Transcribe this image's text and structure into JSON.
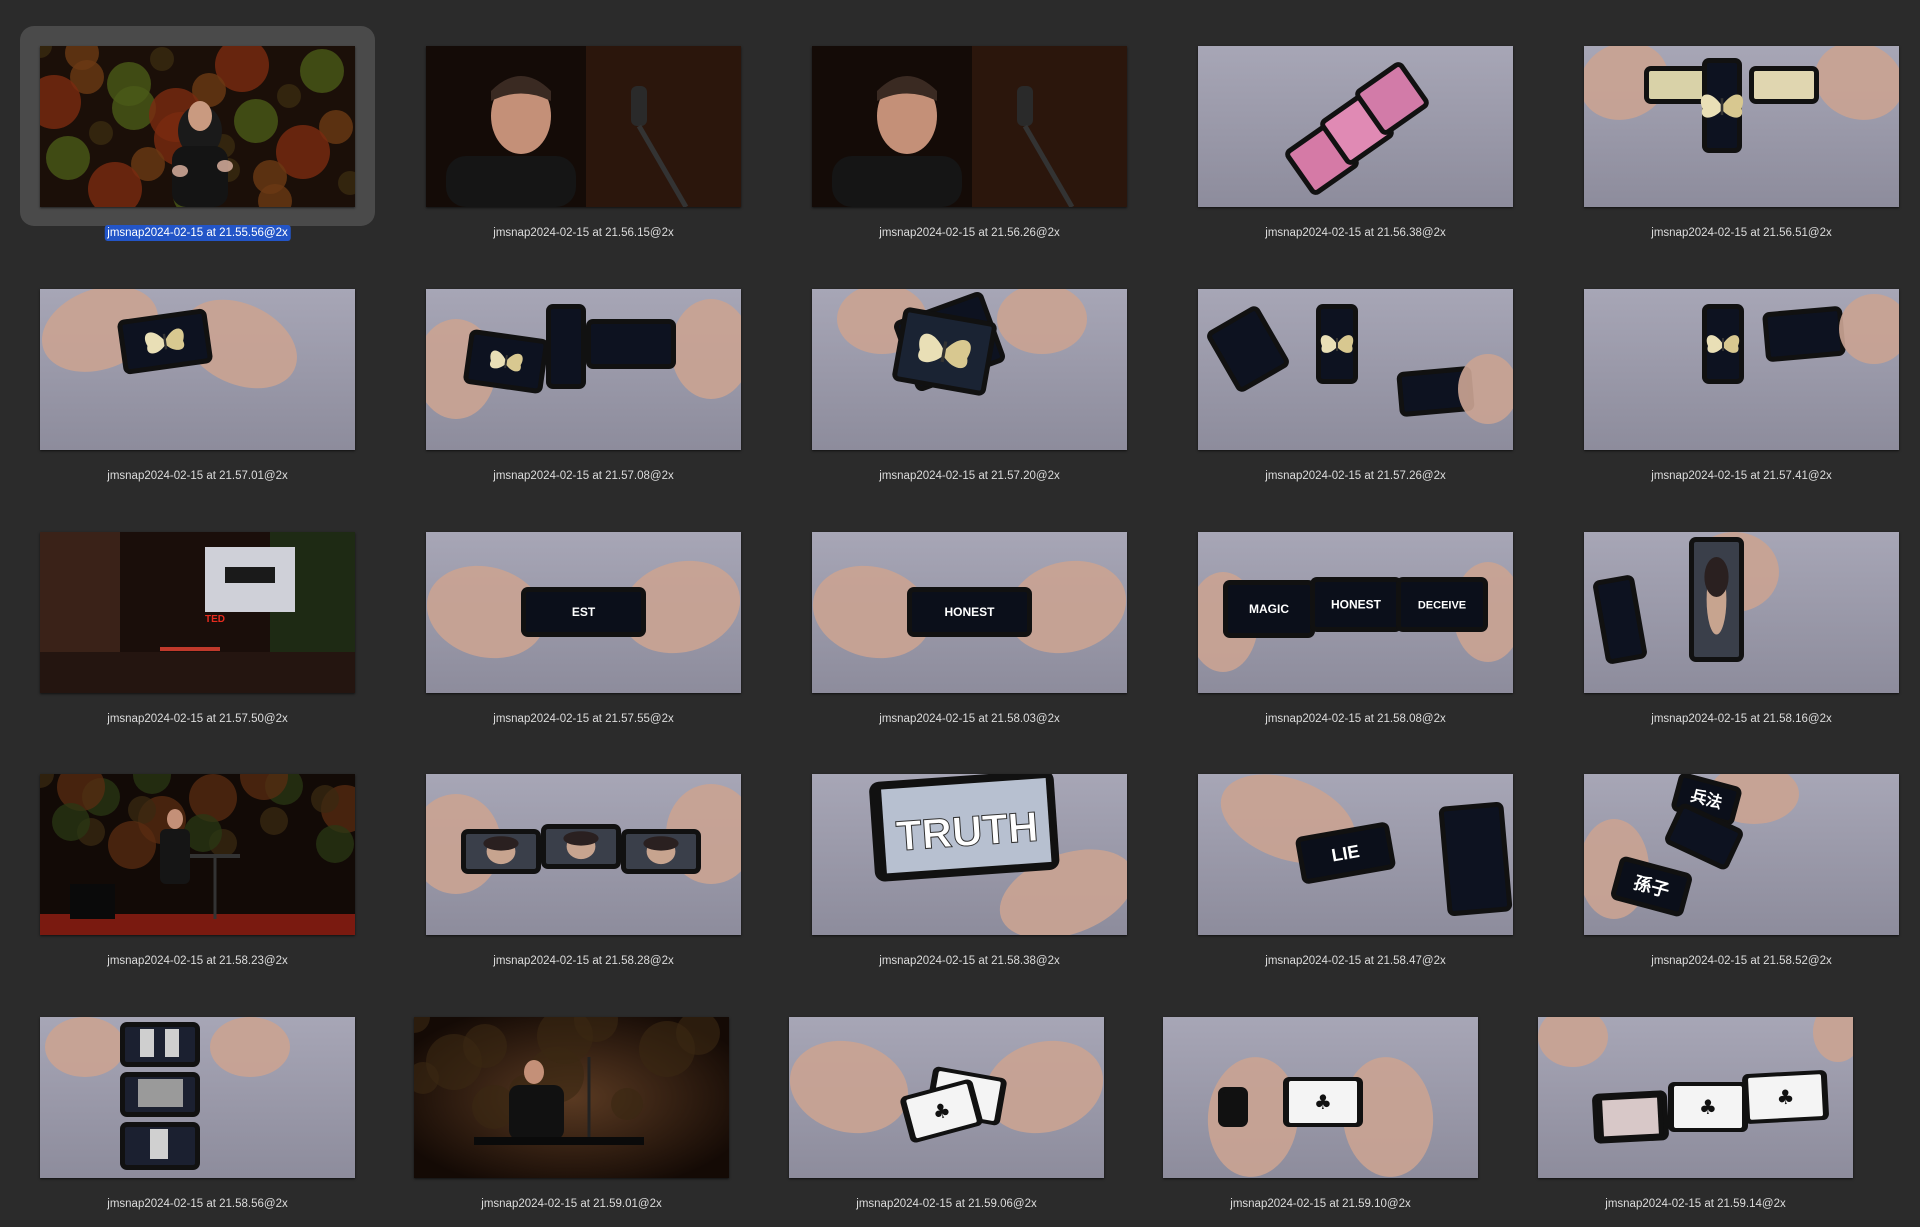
{
  "files": [
    {
      "name": "jmsnap2024-02-15 at 21.55.56@2x",
      "kind": "stage-jungle",
      "selected": true
    },
    {
      "name": "jmsnap2024-02-15 at 21.56.15@2x",
      "kind": "closeup-mic",
      "selected": false
    },
    {
      "name": "jmsnap2024-02-15 at 21.56.26@2x",
      "kind": "closeup-mic",
      "selected": false
    },
    {
      "name": "jmsnap2024-02-15 at 21.56.38@2x",
      "kind": "phones-pink",
      "selected": false
    },
    {
      "name": "jmsnap2024-02-15 at 21.56.51@2x",
      "kind": "phones-butterfly-row",
      "selected": false
    },
    {
      "name": "jmsnap2024-02-15 at 21.57.01@2x",
      "kind": "hand-one-phone",
      "selected": false
    },
    {
      "name": "jmsnap2024-02-15 at 21.57.08@2x",
      "kind": "hands-three-phones",
      "selected": false
    },
    {
      "name": "jmsnap2024-02-15 at 21.57.20@2x",
      "kind": "hands-stack",
      "selected": false
    },
    {
      "name": "jmsnap2024-02-15 at 21.57.26@2x",
      "kind": "three-scattered",
      "selected": false
    },
    {
      "name": "jmsnap2024-02-15 at 21.57.41@2x",
      "kind": "two-phones",
      "selected": false
    },
    {
      "name": "jmsnap2024-02-15 at 21.57.50@2x",
      "kind": "stage-wide",
      "selected": false
    },
    {
      "name": "jmsnap2024-02-15 at 21.57.55@2x",
      "kind": "hands-word",
      "word": "EST",
      "selected": false
    },
    {
      "name": "jmsnap2024-02-15 at 21.58.03@2x",
      "kind": "hands-word",
      "word": "HONEST",
      "selected": false
    },
    {
      "name": "jmsnap2024-02-15 at 21.58.08@2x",
      "kind": "hands-three-words",
      "words": [
        "MAGIC",
        "HONEST",
        "DECEIVE"
      ],
      "selected": false
    },
    {
      "name": "jmsnap2024-02-15 at 21.58.16@2x",
      "kind": "hand-face",
      "selected": false
    },
    {
      "name": "jmsnap2024-02-15 at 21.58.23@2x",
      "kind": "stage-table",
      "selected": false
    },
    {
      "name": "jmsnap2024-02-15 at 21.58.28@2x",
      "kind": "hands-faces",
      "selected": false
    },
    {
      "name": "jmsnap2024-02-15 at 21.58.38@2x",
      "kind": "big-word",
      "word": "TRUTH",
      "selected": false
    },
    {
      "name": "jmsnap2024-02-15 at 21.58.47@2x",
      "kind": "hands-word",
      "word": "LIE",
      "selected": false
    },
    {
      "name": "jmsnap2024-02-15 at 21.58.52@2x",
      "kind": "chinese",
      "words": [
        "兵法",
        "孫子"
      ],
      "selected": false
    },
    {
      "name": "jmsnap2024-02-15 at 21.58.56@2x",
      "kind": "vertical-stack",
      "selected": false
    },
    {
      "name": "jmsnap2024-02-15 at 21.59.01@2x",
      "kind": "stage-dark",
      "selected": false
    },
    {
      "name": "jmsnap2024-02-15 at 21.59.06@2x",
      "kind": "cards-hands",
      "selected": false
    },
    {
      "name": "jmsnap2024-02-15 at 21.59.10@2x",
      "kind": "card-hands-flat",
      "selected": false
    },
    {
      "name": "jmsnap2024-02-15 at 21.59.14@2x",
      "kind": "three-cards",
      "selected": false
    }
  ],
  "labels": {
    "ted": "TED"
  }
}
